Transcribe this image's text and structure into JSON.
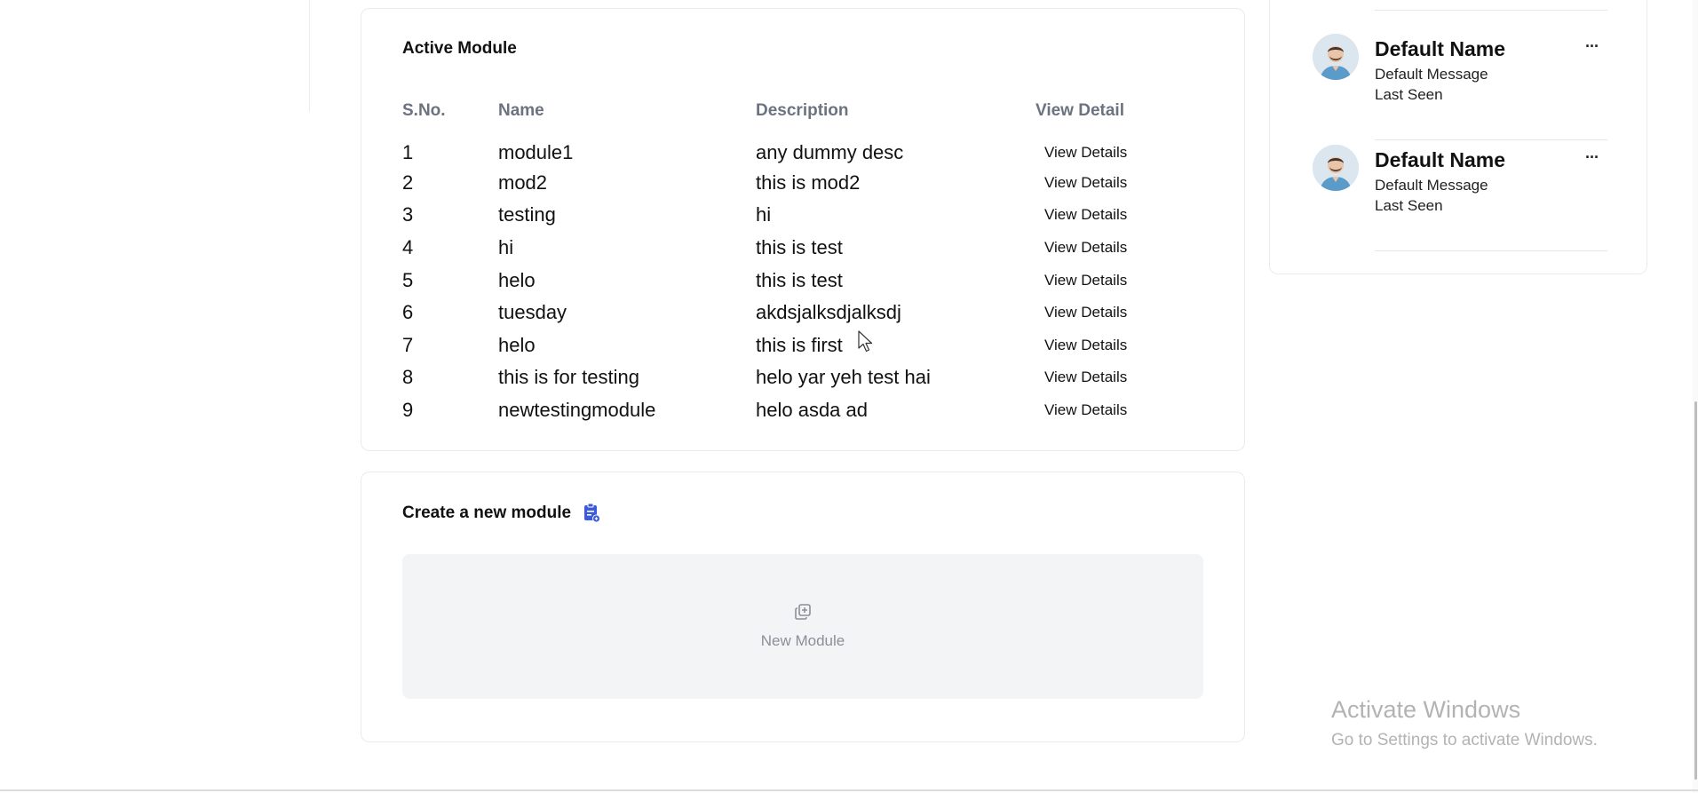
{
  "active_module": {
    "title": "Active Module",
    "columns": [
      "S.No.",
      "Name",
      "Description",
      "View Detail"
    ],
    "rows": [
      {
        "sno": "1",
        "name": "module1",
        "description": "any dummy desc",
        "action": "View Details"
      },
      {
        "sno": "2",
        "name": "mod2",
        "description": "this is mod2",
        "action": "View Details"
      },
      {
        "sno": "3",
        "name": "testing",
        "description": "hi",
        "action": "View Details"
      },
      {
        "sno": "4",
        "name": "hi",
        "description": "this is test",
        "action": "View Details"
      },
      {
        "sno": "5",
        "name": "helo",
        "description": "this is test",
        "action": "View Details"
      },
      {
        "sno": "6",
        "name": "tuesday",
        "description": "akdsjalksdjalksdj",
        "action": "View Details"
      },
      {
        "sno": "7",
        "name": "helo",
        "description": "this is first",
        "action": "View Details"
      },
      {
        "sno": "8",
        "name": "this is for testing",
        "description": "helo yar yeh test hai",
        "action": "View Details"
      },
      {
        "sno": "9",
        "name": "newtestingmodule",
        "description": "helo asda ad",
        "action": "View Details"
      }
    ]
  },
  "create_module": {
    "title": "Create a new module",
    "title_icon": "clipboard-add-icon",
    "new_label": "New Module",
    "new_icon": "copy-add-icon"
  },
  "contacts": [
    {
      "name": "Default Name",
      "message": "Default Message",
      "status": "Last Seen",
      "more": "···"
    },
    {
      "name": "Default Name",
      "message": "Default Message",
      "status": "Last Seen",
      "more": "···"
    }
  ],
  "watermark": {
    "line1": "Activate Windows",
    "line2": "Go to Settings to activate Windows."
  },
  "colors": {
    "accent": "#3b5bdb",
    "muted_header": "#6b7280",
    "panel_bg": "#f3f4f6"
  }
}
